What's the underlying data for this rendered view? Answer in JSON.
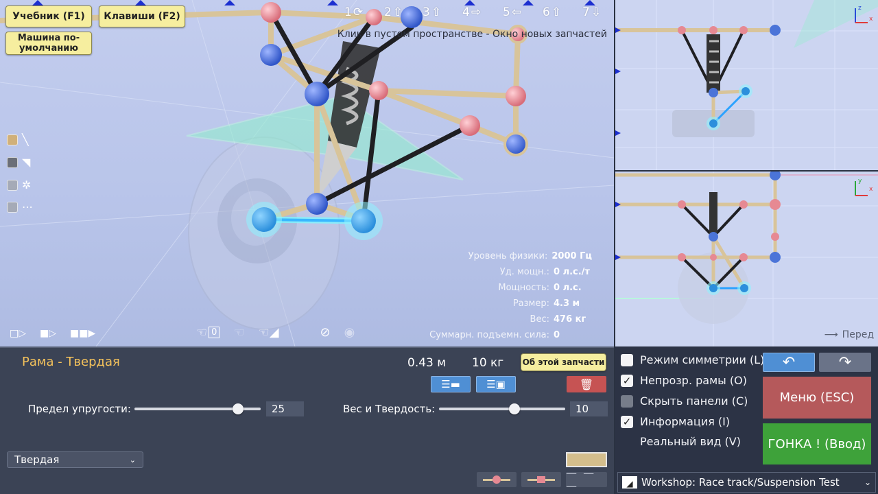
{
  "top_buttons": {
    "tutorial": "Учебник (F1)",
    "keys": "Клавиши (F2)",
    "default_car": "Машина по-умолчанию"
  },
  "views": [
    "1",
    "2",
    "3",
    "4",
    "5",
    "6",
    "7"
  ],
  "hint": "Клик в пустом пространстве - Окно новых запчастей",
  "stats": [
    {
      "label": "Уровень физики:",
      "value": "2000 Гц"
    },
    {
      "label": "Уд. мощн.:",
      "value": "0 л.с./т"
    },
    {
      "label": "Мощность:",
      "value": "0 л.с."
    },
    {
      "label": "Размер:",
      "value": "4.3 м"
    },
    {
      "label": "Вес:",
      "value": "476 кг"
    },
    {
      "label": "Суммарн. подъемн. сила:",
      "value": "0"
    }
  ],
  "legend_icons": [
    "beam-tool-icon",
    "pointer-tool-icon",
    "wheel-tool-icon",
    "more-tool-icon"
  ],
  "bottom_counter": "0",
  "side_front_label": "Перед",
  "part": {
    "title": "Рама - Твердая",
    "length": "0.43 м",
    "weight": "10 кг",
    "about_button": "Об этой запчасти",
    "elastic_label": "Предел упругости:",
    "elastic_value": "25",
    "elastic_fraction": 0.82,
    "weight_hardness_label": "Вес и Твердость:",
    "weight_hardness_value": "10",
    "weight_hardness_fraction": 0.6,
    "material_selected": "Твердая",
    "color": "#d4be8c"
  },
  "options": [
    {
      "label": "Режим симметрии (L)",
      "checked": false
    },
    {
      "label": "Непрозр. рамы (O)",
      "checked": true
    },
    {
      "label": "Скрыть панели (C)",
      "checked": false
    },
    {
      "label": "Информация (I)",
      "checked": true
    },
    {
      "label": "Реальный вид (V)",
      "checked": null
    }
  ],
  "menu_button": "Меню (ESC)",
  "race_button": "ГОНКА ! (Ввод)",
  "track_select": "Workshop:  Race track/Suspension Test",
  "colors": {
    "menu": "#b5595b",
    "race": "#3ea23a",
    "beam": "#d8c49a",
    "node_blue": "#4b74d8",
    "node_pink": "#e68993",
    "selected": "#8ff2ff"
  }
}
